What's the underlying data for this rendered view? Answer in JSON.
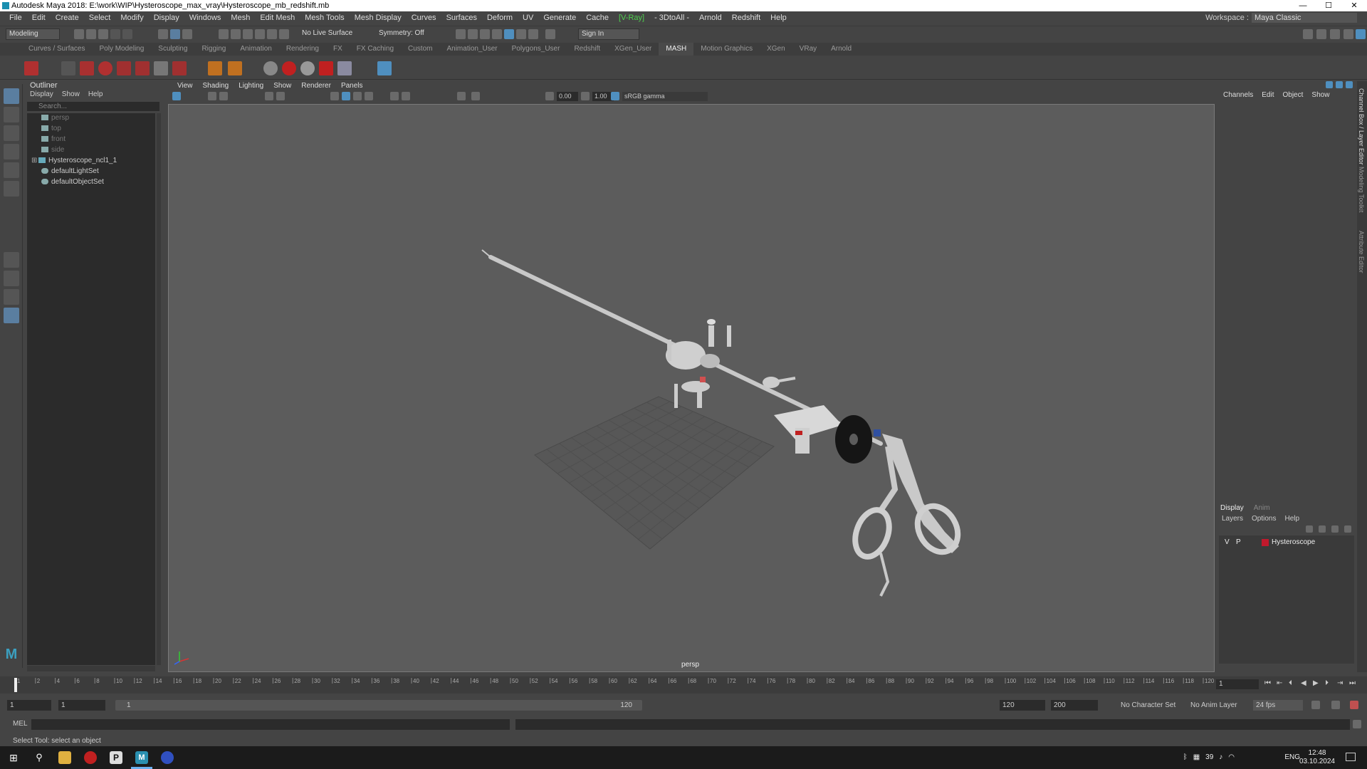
{
  "title": "Autodesk Maya 2018: E:\\work\\WIP\\Hysteroscope_max_vray\\Hysteroscope_mb_redshift.mb",
  "window_controls": {
    "minimize": "—",
    "maximize": "☐",
    "close": "✕"
  },
  "menu": [
    "File",
    "Edit",
    "Create",
    "Select",
    "Modify",
    "Display",
    "Windows",
    "Mesh",
    "Edit Mesh",
    "Mesh Tools",
    "Mesh Display",
    "Curves",
    "Surfaces",
    "Deform",
    "UV",
    "Generate",
    "Cache",
    "[V-Ray]",
    "- 3DtoAll -",
    "Arnold",
    "Redshift",
    "Help"
  ],
  "workspace": {
    "label": "Workspace :",
    "value": "Maya Classic"
  },
  "status": {
    "mode": "Modeling",
    "live_surface": "No Live Surface",
    "symmetry": "Symmetry: Off",
    "sign_in": "Sign In"
  },
  "shelf_tabs": [
    "Curves / Surfaces",
    "Poly Modeling",
    "Sculpting",
    "Rigging",
    "Animation",
    "Rendering",
    "FX",
    "FX Caching",
    "Custom",
    "Animation_User",
    "Polygons_User",
    "Redshift",
    "XGen_User",
    "MASH",
    "Motion Graphics",
    "XGen",
    "VRay",
    "Arnold"
  ],
  "shelf_active": "MASH",
  "outliner": {
    "title": "Outliner",
    "menu": [
      "Display",
      "Show",
      "Help"
    ],
    "search_placeholder": "Search...",
    "items": [
      "persp",
      "top",
      "front",
      "side",
      "Hysteroscope_ncl1_1",
      "defaultLightSet",
      "defaultObjectSet"
    ]
  },
  "viewport": {
    "menu": [
      "View",
      "Shading",
      "Lighting",
      "Show",
      "Renderer",
      "Panels"
    ],
    "exposure": "0.00",
    "gamma": "1.00",
    "color_space": "sRGB gamma",
    "camera_label": "persp"
  },
  "channel_box": {
    "menu": [
      "Channels",
      "Edit",
      "Object",
      "Show"
    ]
  },
  "layer_editor": {
    "tabs": [
      "Display",
      "Anim"
    ],
    "menu": [
      "Layers",
      "Options",
      "Help"
    ],
    "layer": {
      "v": "V",
      "p": "P",
      "name": "Hysteroscope",
      "color": "#c0192c"
    }
  },
  "side_tabs": [
    "Channel Box / Layer Editor",
    "Modeling Toolkit",
    "Attribute Editor"
  ],
  "timeline": {
    "ticks": [
      "1",
      "2",
      "4",
      "6",
      "8",
      "10",
      "12",
      "14",
      "16",
      "18",
      "20",
      "22",
      "24",
      "26",
      "28",
      "30",
      "32",
      "34",
      "36",
      "38",
      "40",
      "42",
      "44",
      "46",
      "48",
      "50",
      "52",
      "54",
      "56",
      "58",
      "60",
      "62",
      "64",
      "66",
      "68",
      "70",
      "72",
      "74",
      "76",
      "78",
      "80",
      "82",
      "84",
      "86",
      "88",
      "90",
      "92",
      "94",
      "96",
      "98",
      "100",
      "102",
      "104",
      "106",
      "108",
      "110",
      "112",
      "114",
      "116",
      "118",
      "120"
    ],
    "current_frame": "1"
  },
  "range": {
    "start": "1",
    "start2": "1",
    "slider_start": "1",
    "slider_end": "120",
    "end": "120",
    "end2": "200",
    "character_set": "No Character Set",
    "anim_layer": "No Anim Layer",
    "fps": "24 fps"
  },
  "cmd": {
    "label": "MEL"
  },
  "help_line": "Select Tool: select an object",
  "taskbar": {
    "time": "12:48",
    "date": "03.10.2024",
    "lang": "ENG",
    "temp": "39"
  }
}
